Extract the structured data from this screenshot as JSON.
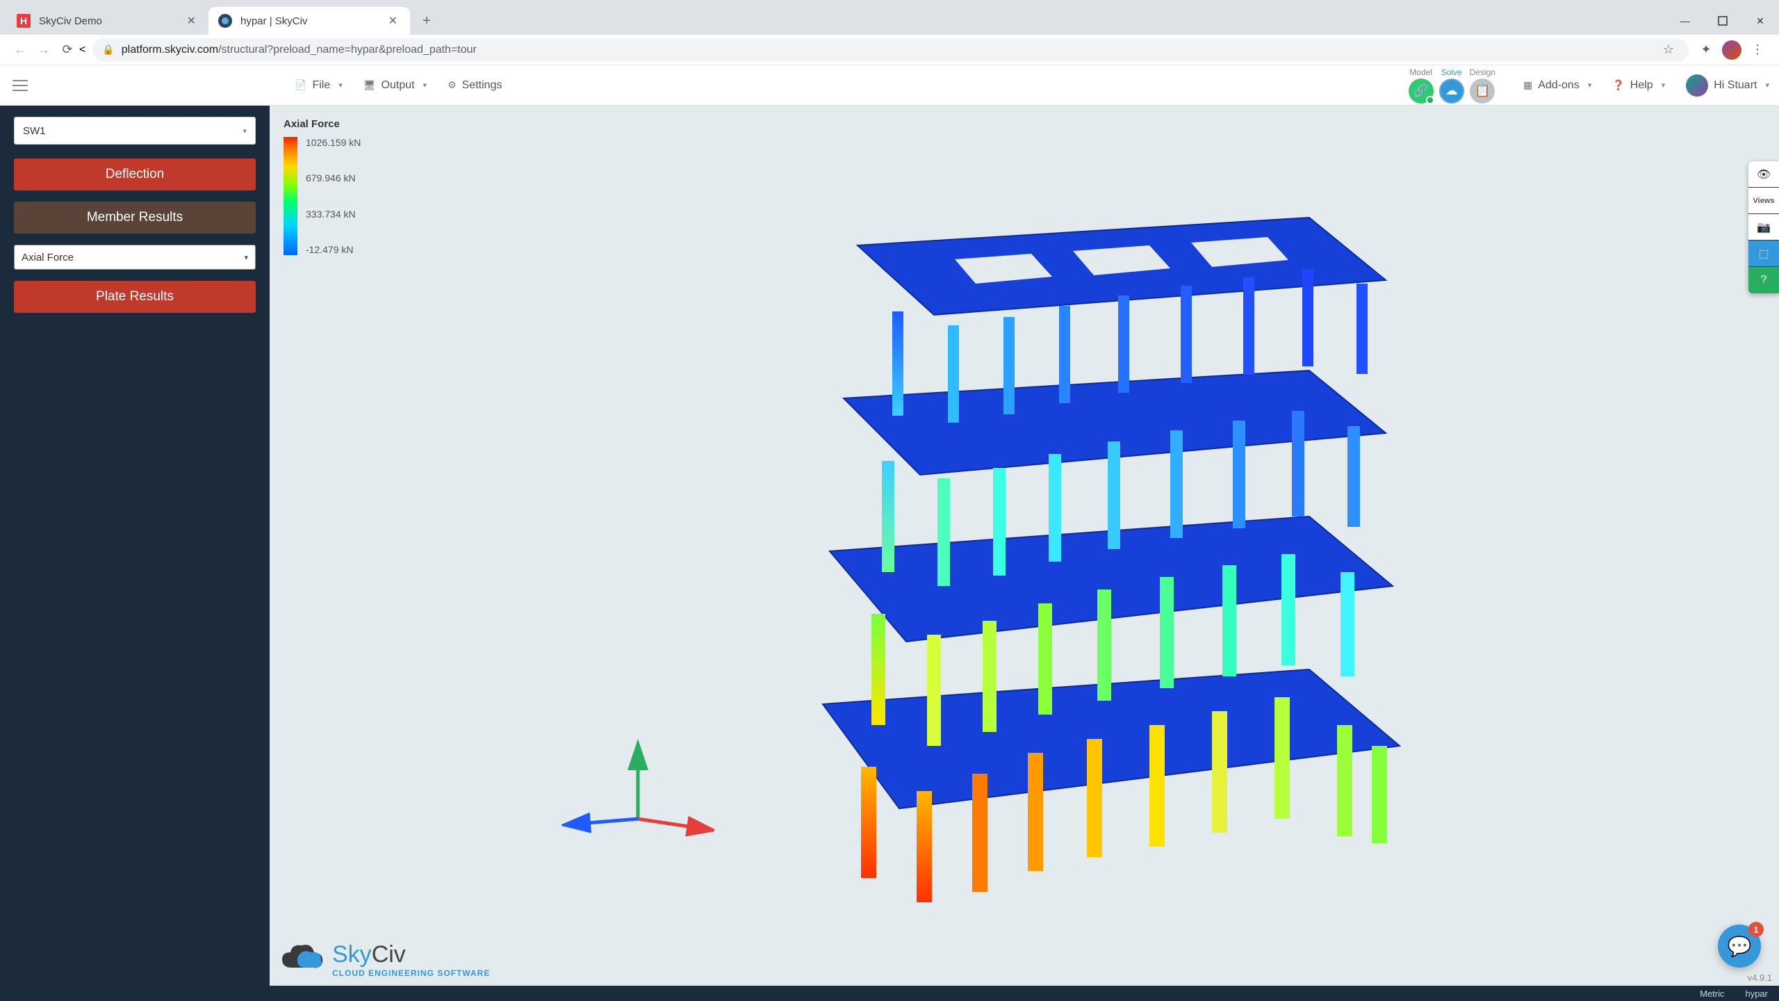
{
  "browser": {
    "tabs": [
      {
        "title": "SkyCiv Demo",
        "active": false
      },
      {
        "title": "hypar | SkyCiv",
        "active": true
      }
    ],
    "url_host": "platform.skyciv.com",
    "url_path": "/structural?preload_name=hypar&preload_path=tour"
  },
  "topbar": {
    "file": "File",
    "output": "Output",
    "settings": "Settings",
    "model": "Model",
    "solve": "Solve",
    "design": "Design",
    "addons": "Add-ons",
    "help": "Help",
    "greeting": "Hi Stuart"
  },
  "sidebar": {
    "load_case": "SW1",
    "deflection": "Deflection",
    "member_results": "Member Results",
    "force_select": "Axial Force",
    "plate_results": "Plate Results"
  },
  "legend": {
    "title": "Axial Force",
    "v0": "1026.159 kN",
    "v1": "679.946 kN",
    "v2": "333.734 kN",
    "v3": "-12.479 kN"
  },
  "float_toolbar": {
    "views_label": "Views"
  },
  "logo": {
    "name_a": "Sky",
    "name_b": "Civ",
    "tagline": "CLOUD ENGINEERING SOFTWARE"
  },
  "version": "v4.9.1",
  "chat_badge": "1",
  "status": {
    "units": "Metric",
    "model": "hypar"
  }
}
